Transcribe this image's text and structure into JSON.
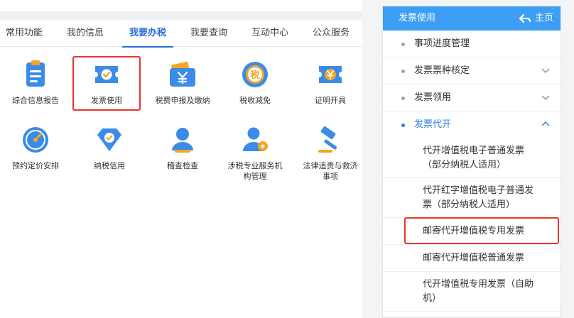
{
  "tabs": [
    {
      "label": "常用功能"
    },
    {
      "label": "我的信息"
    },
    {
      "label": "我要办税"
    },
    {
      "label": "我要查询"
    },
    {
      "label": "互动中心"
    },
    {
      "label": "公众服务"
    }
  ],
  "grid": {
    "row1": [
      {
        "label": "综合信息报告",
        "icon": "report-icon"
      },
      {
        "label": "发票使用",
        "icon": "ticket-check-icon"
      },
      {
        "label": "税费申报及缴纳",
        "icon": "wallet-yen-icon"
      },
      {
        "label": "税收减免",
        "icon": "tax-coin-icon"
      },
      {
        "label": "证明开具",
        "icon": "ticket-yen-icon"
      }
    ],
    "row2": [
      {
        "label": "预约定价安排",
        "icon": "gauge-icon"
      },
      {
        "label": "纳税信用",
        "icon": "diamond-check-icon"
      },
      {
        "label": "稽查检查",
        "icon": "person-icon"
      },
      {
        "label": "涉税专业服务机构管理",
        "label_l1": "涉税专业服务机",
        "label_l2": "构管理",
        "icon": "person-gear-icon"
      },
      {
        "label": "法律追责与救济事项",
        "label_l1": "法律追责与救济",
        "label_l2": "事项",
        "icon": "gavel-icon"
      }
    ]
  },
  "side": {
    "header_title": "发票使用",
    "home_label": "主页",
    "items": [
      {
        "label": "事项进度管理"
      },
      {
        "label": "发票票种核定"
      },
      {
        "label": "发票领用"
      },
      {
        "label": "发票代开"
      }
    ],
    "sub_items": [
      {
        "l1": "代开增值税电子普通发票",
        "l2": "（部分纳税人适用）"
      },
      {
        "l1": "代开红字增值税电子普通发",
        "l2": "票（部分纳税人适用）"
      },
      {
        "l1": "邮寄代开增值税专用发票"
      },
      {
        "l1": "邮寄代开增值税普通发票"
      },
      {
        "l1": "代开增值税专用发票（自助",
        "l2": "机）"
      }
    ]
  },
  "colors": {
    "accent": "#2a6fd6",
    "header_blue": "#3d9ef5",
    "highlight_red": "#e8342e",
    "icon_blue": "#3b8be8",
    "icon_orange": "#f5a623"
  }
}
